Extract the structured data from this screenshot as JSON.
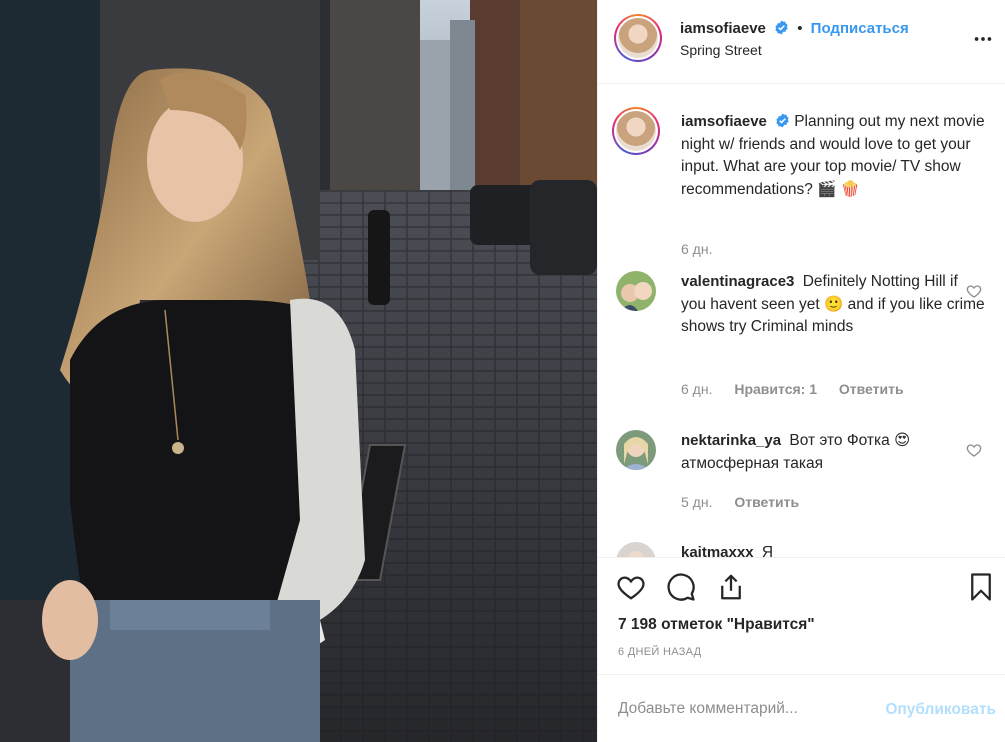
{
  "post": {
    "username": "iamsofiaeve",
    "follow_label": "Подписаться",
    "location": "Spring Street",
    "caption_text": "Planning out my next movie night w/ friends and would love to get your input. What are your top movie/ TV show recommendations? 🎬 🍿",
    "caption_time": "6 дн.",
    "likes": "7 198 отметок \"Нравится\"",
    "timestamp": "6 ДНЕЙ НАЗАД",
    "add_comment_placeholder": "Добавьте комментарий...",
    "publish_label": "Опубликовать"
  },
  "comments": [
    {
      "username": "valentinagrace3",
      "text": "Definitely Notting Hill if you havent seen yet 🙂 and if you like crime shows try Criminal minds",
      "time": "6 дн.",
      "likes": "Нравится: 1",
      "reply": "Ответить"
    },
    {
      "username": "nektarinka_ya",
      "text": "Вот это Фотка 😍 атмосферная такая",
      "time": "5 дн.",
      "reply": "Ответить"
    },
    {
      "username": "kaitmaxxx",
      "text": "Я"
    }
  ],
  "colors": {
    "link_blue": "#3897f0",
    "disabled_blue": "#b2dffc",
    "muted_gray": "#8e8e8e",
    "text_dark": "#262626"
  },
  "icons": [
    "verified-icon",
    "more-options-icon",
    "heart-icon",
    "comment-icon",
    "share-icon",
    "bookmark-icon"
  ]
}
